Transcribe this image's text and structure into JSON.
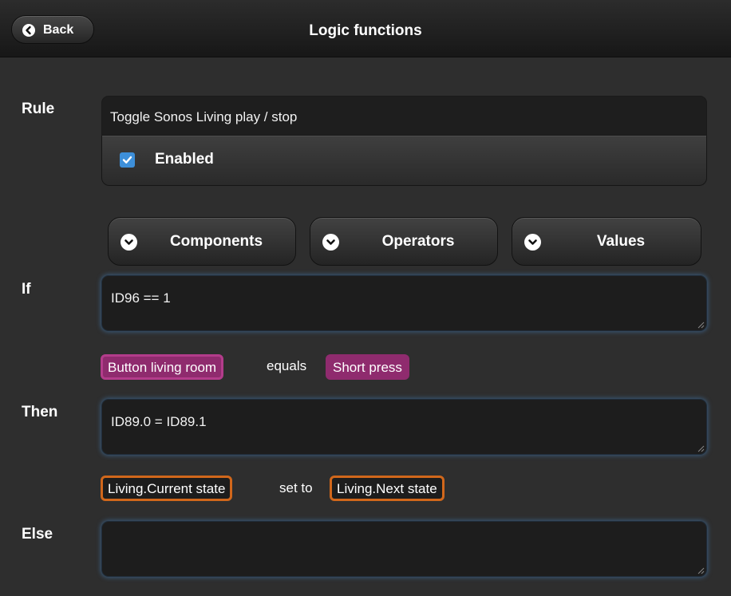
{
  "header": {
    "title": "Logic functions",
    "back_label": "Back"
  },
  "rule": {
    "label": "Rule",
    "value": "Toggle Sonos Living play / stop",
    "enabled_label": "Enabled",
    "enabled": true
  },
  "picker_buttons": [
    {
      "label": "Components",
      "icon": "chevron-down-icon"
    },
    {
      "label": "Operators",
      "icon": "chevron-down-icon"
    },
    {
      "label": "Values",
      "icon": "chevron-down-icon"
    }
  ],
  "if_section": {
    "label": "If",
    "value": "ID96 == 1",
    "tokens": {
      "subject": "Button living room",
      "connector": "equals",
      "object": "Short press"
    }
  },
  "then_section": {
    "label": "Then",
    "value": "ID89.0 = ID89.1",
    "tokens": {
      "subject": "Living.Current state",
      "connector": "set to",
      "object": "Living.Next state"
    }
  },
  "else_section": {
    "label": "Else",
    "value": ""
  },
  "colors": {
    "checkbox": "#3d8fd9",
    "tag_purple": "#8f2b6e",
    "tag_orange_border": "#d1671b",
    "focus_glow": "#4682be"
  }
}
